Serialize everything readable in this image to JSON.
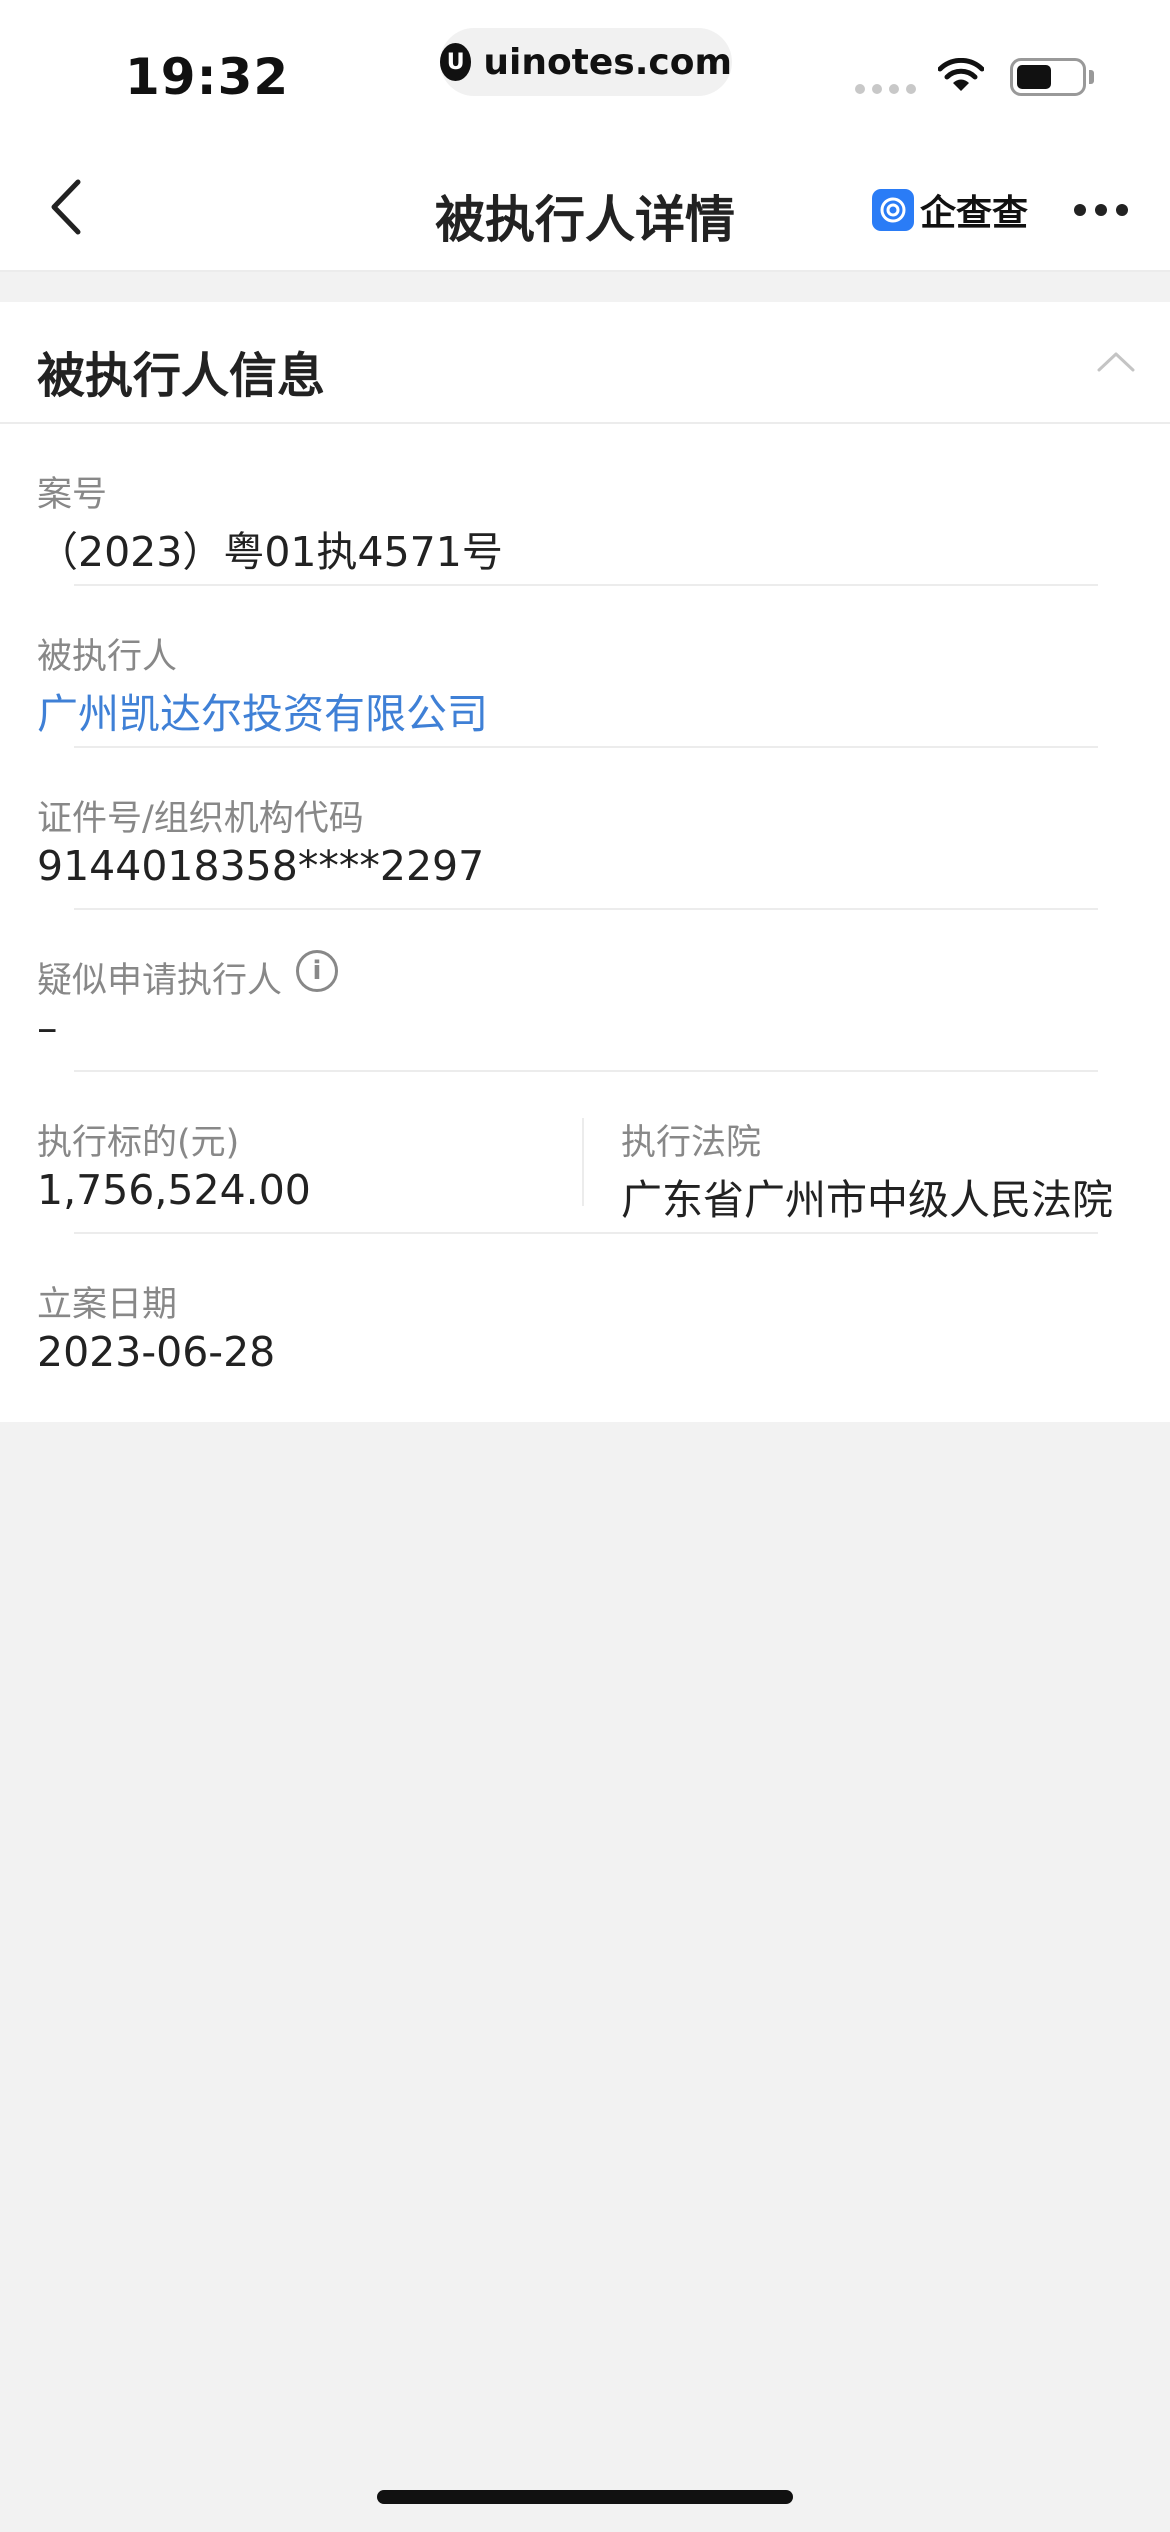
{
  "status_bar": {
    "time": "19:32",
    "url": "uinotes.com",
    "url_logo_char": "U"
  },
  "navbar": {
    "title": "被执行人详情",
    "brand": "企查查",
    "brand_color": "#2a7cf6"
  },
  "section": {
    "title": "被执行人信息"
  },
  "fields": {
    "case_no": {
      "label": "案号",
      "value": "（2023）粤01执4571号"
    },
    "executee": {
      "label": "被执行人",
      "value": "广州凯达尔投资有限公司"
    },
    "id_no": {
      "label": "证件号/组织机构代码",
      "value": "9144018358****2297"
    },
    "applicant": {
      "label": "疑似申请执行人",
      "value": "–",
      "info_char": "i"
    },
    "amount": {
      "label": "执行标的(元)",
      "value": "1,756,524.00"
    },
    "court": {
      "label": "执行法院",
      "value": "广东省广州市中级人民法院"
    },
    "filing_date": {
      "label": "立案日期",
      "value": "2023-06-28"
    }
  },
  "colors": {
    "link": "#3f80d6",
    "label": "#888888",
    "background": "#f2f2f2"
  }
}
